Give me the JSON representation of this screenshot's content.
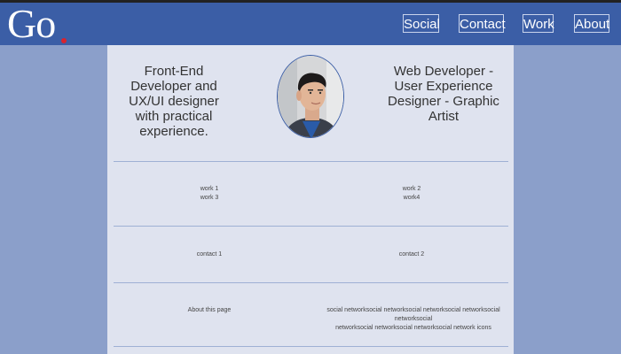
{
  "header": {
    "logo_text": "Go",
    "nav": [
      {
        "label": "Social"
      },
      {
        "label": "Contact"
      },
      {
        "label": "Work"
      },
      {
        "label": "About"
      }
    ]
  },
  "intro": {
    "left_text": "Front-End Developer and UX/UI designer with practical experience.",
    "right_text": "Web Developer - User Experience Designer - Graphic Artist"
  },
  "work": {
    "left": [
      "work 1",
      "work 3"
    ],
    "right": [
      "work 2",
      "work4"
    ]
  },
  "contact": {
    "left": "contact 1",
    "right": "contact 2"
  },
  "about": {
    "left": "About this page",
    "right_line1": "social networksocial networksocial networksocial networksocial networksocial",
    "right_line2": "networksocial networksocial networksocial network icons"
  },
  "colors": {
    "navbar": "#3b5ea6",
    "page_background": "#8b9fca",
    "content_background": "#dfe3ef",
    "logo_dot": "#d9232e"
  },
  "icons": {
    "avatar": "profile-photo"
  }
}
